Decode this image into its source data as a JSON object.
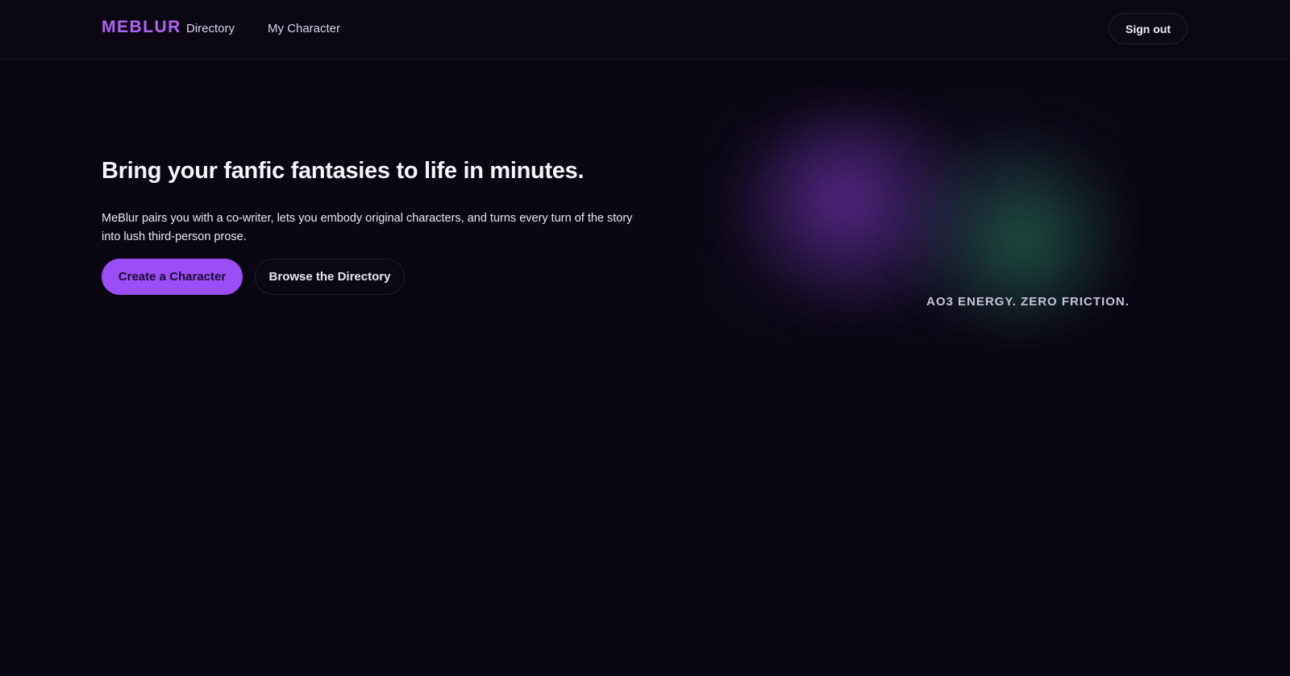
{
  "header": {
    "brand": "MEBLUR",
    "nav": [
      {
        "label": "Directory"
      },
      {
        "label": "My Character"
      }
    ],
    "sign_out_label": "Sign out"
  },
  "hero": {
    "title": "Bring your fanfic fantasies to life in minutes.",
    "description": "MeBlur pairs you with a co-writer, lets you embody original characters, and turns every turn of the story into lush third-person prose.",
    "primary_cta": "Create a Character",
    "secondary_cta": "Browse the Directory"
  },
  "showcase": {
    "caption": "AO3 ENERGY. ZERO FRICTION."
  },
  "colors": {
    "background": "#0a0713",
    "accent": "#9b4df6",
    "brand": "#b066f5",
    "glow_purple": "#7030aa",
    "glow_green": "#226e4e"
  }
}
